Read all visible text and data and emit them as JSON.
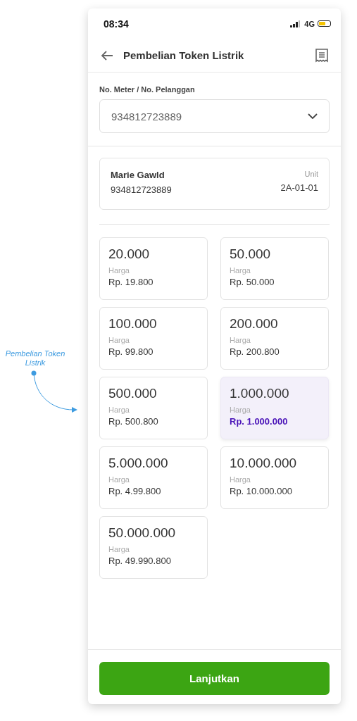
{
  "annotation": {
    "text": "Pembelian Token Listrik"
  },
  "status_bar": {
    "time": "08:34",
    "network": "4G"
  },
  "header": {
    "title": "Pembelian Token Listrik"
  },
  "meter_field": {
    "label": "No. Meter / No. Pelanggan",
    "value": "934812723889"
  },
  "customer": {
    "name": "Marie Gawld",
    "number": "934812723889",
    "unit_label": "Unit",
    "unit": "2A-01-01"
  },
  "options": [
    {
      "amount": "20.000",
      "price_label": "Harga",
      "price": "Rp. 19.800",
      "selected": false
    },
    {
      "amount": "50.000",
      "price_label": "Harga",
      "price": "Rp. 50.000",
      "selected": false
    },
    {
      "amount": "100.000",
      "price_label": "Harga",
      "price": "Rp. 99.800",
      "selected": false
    },
    {
      "amount": "200.000",
      "price_label": "Harga",
      "price": "Rp. 200.800",
      "selected": false
    },
    {
      "amount": "500.000",
      "price_label": "Harga",
      "price": "Rp. 500.800",
      "selected": false
    },
    {
      "amount": "1.000.000",
      "price_label": "Harga",
      "price": "Rp. 1.000.000",
      "selected": true
    },
    {
      "amount": "5.000.000",
      "price_label": "Harga",
      "price": "Rp. 4.99.800",
      "selected": false
    },
    {
      "amount": "10.000.000",
      "price_label": "Harga",
      "price": "Rp. 10.000.000",
      "selected": false
    },
    {
      "amount": "50.000.000",
      "price_label": "Harga",
      "price": "Rp. 49.990.800",
      "selected": false
    }
  ],
  "continue_button": {
    "label": "Lanjutkan"
  }
}
